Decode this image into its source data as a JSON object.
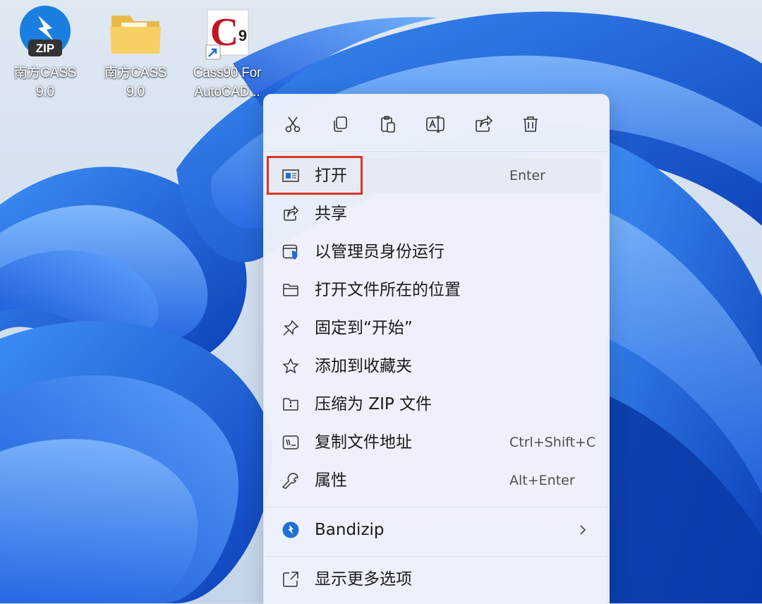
{
  "desktop": {
    "icons": [
      {
        "label": "南方CASS\n9.0",
        "icon": "zip-installer-icon",
        "badge": "ZIP"
      },
      {
        "label": "南方CASS\n9.0",
        "icon": "folder-icon"
      },
      {
        "label": "Cass90 For\nAutoCAD...",
        "icon": "cass9-shortcut-icon",
        "badge": "9"
      }
    ]
  },
  "context_menu": {
    "toolbar": [
      {
        "action": "cut",
        "icon": "scissors-icon"
      },
      {
        "action": "copy",
        "icon": "copy-icon"
      },
      {
        "action": "paste",
        "icon": "paste-icon"
      },
      {
        "action": "rename",
        "icon": "rename-icon"
      },
      {
        "action": "share",
        "icon": "share-icon"
      },
      {
        "action": "delete",
        "icon": "trash-icon"
      }
    ],
    "items": [
      {
        "label": "打开",
        "shortcut": "Enter",
        "icon": "open-window-icon",
        "highlighted": true
      },
      {
        "label": "共享",
        "shortcut": "",
        "icon": "share-icon"
      },
      {
        "label": "以管理员身份运行",
        "shortcut": "",
        "icon": "admin-shield-icon"
      },
      {
        "label": "打开文件所在的位置",
        "shortcut": "",
        "icon": "folder-icon"
      },
      {
        "label": "固定到“开始”",
        "shortcut": "",
        "icon": "pin-icon"
      },
      {
        "label": "添加到收藏夹",
        "shortcut": "",
        "icon": "star-icon"
      },
      {
        "label": "压缩为 ZIP 文件",
        "shortcut": "",
        "icon": "zip-archive-icon"
      },
      {
        "label": "复制文件地址",
        "shortcut": "Ctrl+Shift+C",
        "icon": "copy-path-icon"
      },
      {
        "label": "属性",
        "shortcut": "Alt+Enter",
        "icon": "wrench-icon"
      },
      {
        "label": "Bandizip",
        "shortcut": "",
        "icon": "bandizip-icon",
        "submenu": true
      },
      {
        "label": "显示更多选项",
        "shortcut": "",
        "icon": "show-more-icon"
      }
    ]
  },
  "colors": {
    "highlight_border": "#d9342b",
    "menu_background": "#eef2fb",
    "bandizip_blue": "#1f6fd8"
  }
}
